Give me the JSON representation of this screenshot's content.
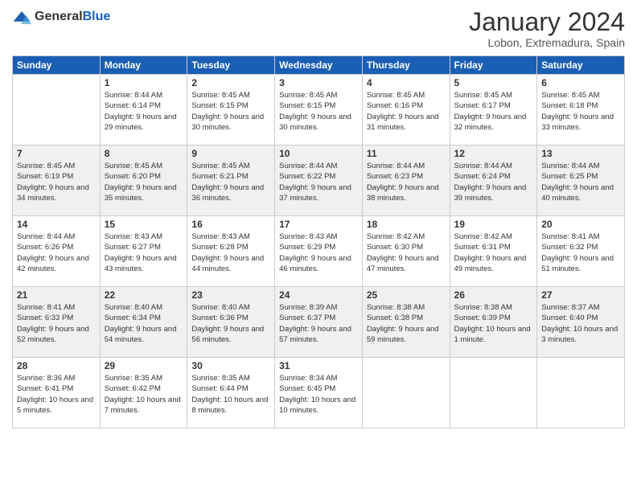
{
  "header": {
    "logo_line1": "General",
    "logo_line2": "Blue",
    "month": "January 2024",
    "location": "Lobon, Extremadura, Spain"
  },
  "weekdays": [
    "Sunday",
    "Monday",
    "Tuesday",
    "Wednesday",
    "Thursday",
    "Friday",
    "Saturday"
  ],
  "weeks": [
    [
      {
        "day": "",
        "sunrise": "",
        "sunset": "",
        "daylight": ""
      },
      {
        "day": "1",
        "sunrise": "Sunrise: 8:44 AM",
        "sunset": "Sunset: 6:14 PM",
        "daylight": "Daylight: 9 hours and 29 minutes."
      },
      {
        "day": "2",
        "sunrise": "Sunrise: 8:45 AM",
        "sunset": "Sunset: 6:15 PM",
        "daylight": "Daylight: 9 hours and 30 minutes."
      },
      {
        "day": "3",
        "sunrise": "Sunrise: 8:45 AM",
        "sunset": "Sunset: 6:15 PM",
        "daylight": "Daylight: 9 hours and 30 minutes."
      },
      {
        "day": "4",
        "sunrise": "Sunrise: 8:45 AM",
        "sunset": "Sunset: 6:16 PM",
        "daylight": "Daylight: 9 hours and 31 minutes."
      },
      {
        "day": "5",
        "sunrise": "Sunrise: 8:45 AM",
        "sunset": "Sunset: 6:17 PM",
        "daylight": "Daylight: 9 hours and 32 minutes."
      },
      {
        "day": "6",
        "sunrise": "Sunrise: 8:45 AM",
        "sunset": "Sunset: 6:18 PM",
        "daylight": "Daylight: 9 hours and 33 minutes."
      }
    ],
    [
      {
        "day": "7",
        "sunrise": "Sunrise: 8:45 AM",
        "sunset": "Sunset: 6:19 PM",
        "daylight": "Daylight: 9 hours and 34 minutes."
      },
      {
        "day": "8",
        "sunrise": "Sunrise: 8:45 AM",
        "sunset": "Sunset: 6:20 PM",
        "daylight": "Daylight: 9 hours and 35 minutes."
      },
      {
        "day": "9",
        "sunrise": "Sunrise: 8:45 AM",
        "sunset": "Sunset: 6:21 PM",
        "daylight": "Daylight: 9 hours and 36 minutes."
      },
      {
        "day": "10",
        "sunrise": "Sunrise: 8:44 AM",
        "sunset": "Sunset: 6:22 PM",
        "daylight": "Daylight: 9 hours and 37 minutes."
      },
      {
        "day": "11",
        "sunrise": "Sunrise: 8:44 AM",
        "sunset": "Sunset: 6:23 PM",
        "daylight": "Daylight: 9 hours and 38 minutes."
      },
      {
        "day": "12",
        "sunrise": "Sunrise: 8:44 AM",
        "sunset": "Sunset: 6:24 PM",
        "daylight": "Daylight: 9 hours and 39 minutes."
      },
      {
        "day": "13",
        "sunrise": "Sunrise: 8:44 AM",
        "sunset": "Sunset: 6:25 PM",
        "daylight": "Daylight: 9 hours and 40 minutes."
      }
    ],
    [
      {
        "day": "14",
        "sunrise": "Sunrise: 8:44 AM",
        "sunset": "Sunset: 6:26 PM",
        "daylight": "Daylight: 9 hours and 42 minutes."
      },
      {
        "day": "15",
        "sunrise": "Sunrise: 8:43 AM",
        "sunset": "Sunset: 6:27 PM",
        "daylight": "Daylight: 9 hours and 43 minutes."
      },
      {
        "day": "16",
        "sunrise": "Sunrise: 8:43 AM",
        "sunset": "Sunset: 6:28 PM",
        "daylight": "Daylight: 9 hours and 44 minutes."
      },
      {
        "day": "17",
        "sunrise": "Sunrise: 8:43 AM",
        "sunset": "Sunset: 6:29 PM",
        "daylight": "Daylight: 9 hours and 46 minutes."
      },
      {
        "day": "18",
        "sunrise": "Sunrise: 8:42 AM",
        "sunset": "Sunset: 6:30 PM",
        "daylight": "Daylight: 9 hours and 47 minutes."
      },
      {
        "day": "19",
        "sunrise": "Sunrise: 8:42 AM",
        "sunset": "Sunset: 6:31 PM",
        "daylight": "Daylight: 9 hours and 49 minutes."
      },
      {
        "day": "20",
        "sunrise": "Sunrise: 8:41 AM",
        "sunset": "Sunset: 6:32 PM",
        "daylight": "Daylight: 9 hours and 51 minutes."
      }
    ],
    [
      {
        "day": "21",
        "sunrise": "Sunrise: 8:41 AM",
        "sunset": "Sunset: 6:33 PM",
        "daylight": "Daylight: 9 hours and 52 minutes."
      },
      {
        "day": "22",
        "sunrise": "Sunrise: 8:40 AM",
        "sunset": "Sunset: 6:34 PM",
        "daylight": "Daylight: 9 hours and 54 minutes."
      },
      {
        "day": "23",
        "sunrise": "Sunrise: 8:40 AM",
        "sunset": "Sunset: 6:36 PM",
        "daylight": "Daylight: 9 hours and 56 minutes."
      },
      {
        "day": "24",
        "sunrise": "Sunrise: 8:39 AM",
        "sunset": "Sunset: 6:37 PM",
        "daylight": "Daylight: 9 hours and 57 minutes."
      },
      {
        "day": "25",
        "sunrise": "Sunrise: 8:38 AM",
        "sunset": "Sunset: 6:38 PM",
        "daylight": "Daylight: 9 hours and 59 minutes."
      },
      {
        "day": "26",
        "sunrise": "Sunrise: 8:38 AM",
        "sunset": "Sunset: 6:39 PM",
        "daylight": "Daylight: 10 hours and 1 minute."
      },
      {
        "day": "27",
        "sunrise": "Sunrise: 8:37 AM",
        "sunset": "Sunset: 6:40 PM",
        "daylight": "Daylight: 10 hours and 3 minutes."
      }
    ],
    [
      {
        "day": "28",
        "sunrise": "Sunrise: 8:36 AM",
        "sunset": "Sunset: 6:41 PM",
        "daylight": "Daylight: 10 hours and 5 minutes."
      },
      {
        "day": "29",
        "sunrise": "Sunrise: 8:35 AM",
        "sunset": "Sunset: 6:42 PM",
        "daylight": "Daylight: 10 hours and 7 minutes."
      },
      {
        "day": "30",
        "sunrise": "Sunrise: 8:35 AM",
        "sunset": "Sunset: 6:44 PM",
        "daylight": "Daylight: 10 hours and 8 minutes."
      },
      {
        "day": "31",
        "sunrise": "Sunrise: 8:34 AM",
        "sunset": "Sunset: 6:45 PM",
        "daylight": "Daylight: 10 hours and 10 minutes."
      },
      {
        "day": "",
        "sunrise": "",
        "sunset": "",
        "daylight": ""
      },
      {
        "day": "",
        "sunrise": "",
        "sunset": "",
        "daylight": ""
      },
      {
        "day": "",
        "sunrise": "",
        "sunset": "",
        "daylight": ""
      }
    ]
  ]
}
